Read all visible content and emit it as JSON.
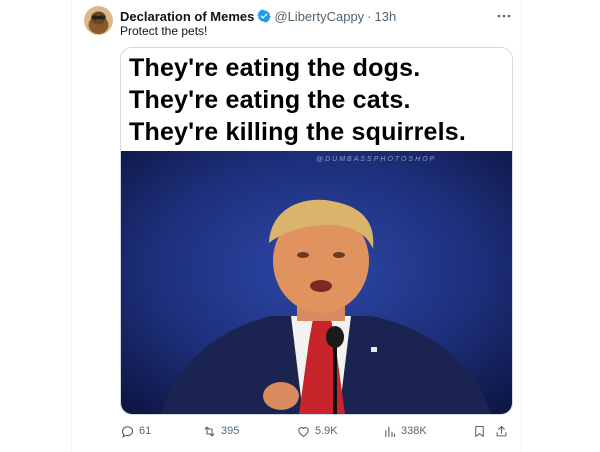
{
  "post": {
    "author_name": "Declaration of Memes",
    "handle": "@LibertyCappy",
    "separator": "·",
    "time": "13h",
    "text": "Protect the pets!"
  },
  "media": {
    "caption_lines": [
      "They're eating the dogs.",
      "They're eating the cats.",
      "They're killing the squirrels."
    ],
    "watermark": "@DUMBASSPHOTOSHOP"
  },
  "actions": {
    "replies": "61",
    "reposts": "395",
    "likes": "5.9K",
    "views": "338K"
  },
  "icons": {
    "verified": "verified-badge-icon",
    "more": "more-icon",
    "reply": "reply-icon",
    "repost": "repost-icon",
    "like": "heart-icon",
    "views": "views-icon",
    "bookmark": "bookmark-icon",
    "share": "share-icon"
  },
  "colors": {
    "verified": "#1d9bf0",
    "muted": "#536471",
    "photo_bg": "#1f2f74"
  }
}
